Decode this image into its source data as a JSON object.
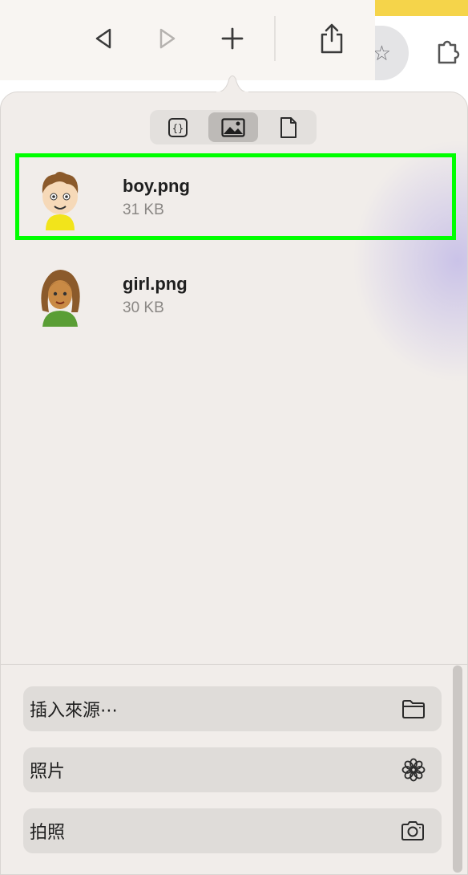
{
  "toolbar": {
    "back_icon": "back-triangle-icon",
    "forward_icon": "forward-triangle-icon",
    "new_tab_icon": "plus-icon",
    "share_icon": "share-icon"
  },
  "popover": {
    "segments": [
      {
        "name": "json",
        "icon": "braces-icon",
        "active": false
      },
      {
        "name": "images",
        "icon": "image-icon",
        "active": true
      },
      {
        "name": "files",
        "icon": "document-icon",
        "active": false
      }
    ],
    "files": [
      {
        "name": "boy.png",
        "size": "31 KB",
        "selected": true
      },
      {
        "name": "girl.png",
        "size": "30 KB",
        "selected": false
      }
    ],
    "actions": [
      {
        "label": "插入來源⋯",
        "icon": "folder-icon"
      },
      {
        "label": "照片",
        "icon": "flower-icon"
      },
      {
        "label": "拍照",
        "icon": "camera-icon"
      }
    ]
  },
  "colors": {
    "selection_outline": "#00ff00",
    "popover_bg": "#f1edea",
    "yellow_tab": "#f5d44a"
  }
}
